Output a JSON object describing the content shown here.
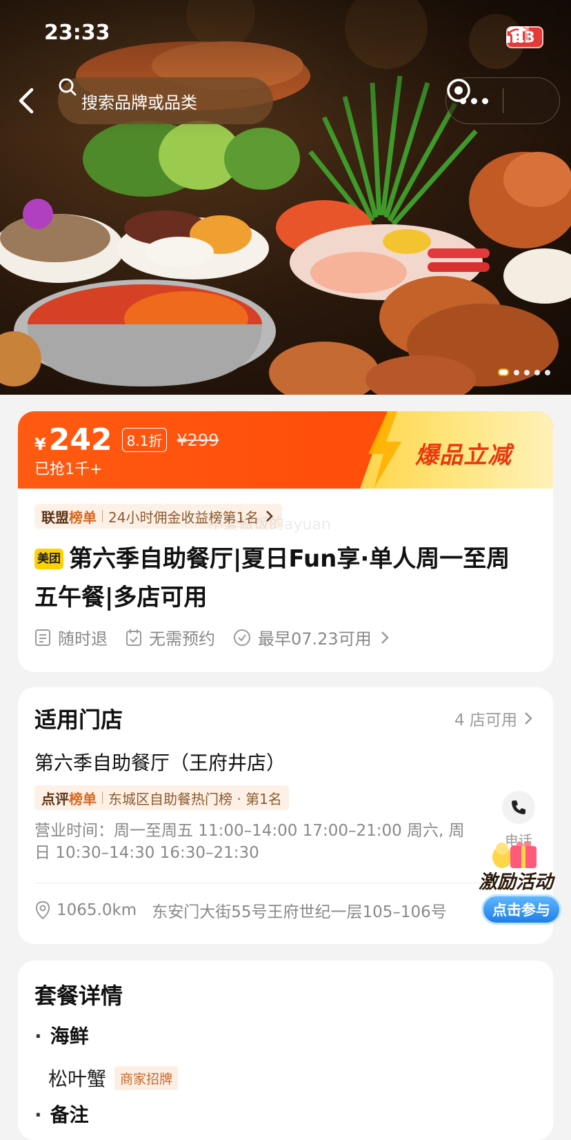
{
  "status_bar": {
    "time": "23:33",
    "battery": "13"
  },
  "nav": {
    "search_placeholder": "搜索品牌或品类"
  },
  "price_card": {
    "currency": "¥",
    "price": "242",
    "discount": "8.1折",
    "original_price": "¥299",
    "sold": "已抢1千+",
    "promo": "爆品立减",
    "rank_brand_prefix": "联盟",
    "rank_brand_suffix": "榜单",
    "rank_text": "24小时佣金收益榜第1名",
    "watermark": "不爱做饭的ayuan",
    "platform_badge": "美团",
    "title": "第六季自助餐厅|夏日Fun享·单人周一至周五午餐|多店可用",
    "features": [
      "随时退",
      "无需预约",
      "最早07.23可用"
    ]
  },
  "store_card": {
    "title": "适用门店",
    "count": "4 店可用",
    "store_name": "第六季自助餐厅（王府井店）",
    "rank_prefix": "点评",
    "rank_suffix": "榜单",
    "rank_text": "东城区自助餐热门榜 · 第1名",
    "hours": "营业时间：周一至周五 11:00–14:00 17:00–21:00 周六, 周日 10:30–14:30 16:30–21:30",
    "phone_label": "电话",
    "distance": "1065.0km",
    "address": "东安门大街55号王府世纪一层105–106号"
  },
  "package_card": {
    "title": "套餐详情",
    "category1": "海鲜",
    "item1": "松叶蟹",
    "item1_tag": "商家招牌",
    "category2": "备注"
  },
  "activity": {
    "title": "激励活动",
    "button": "点击参与"
  },
  "colors": {
    "accent": "#ff5a12",
    "promo_yellow": "#ffd44a",
    "meituan_yellow": "#ffd100"
  }
}
